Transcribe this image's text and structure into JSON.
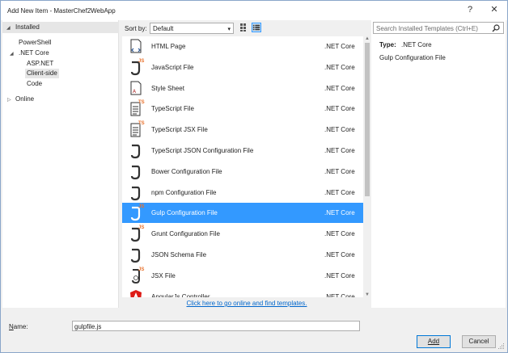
{
  "window": {
    "title": "Add New Item - MasterChef2WebApp",
    "help_glyph": "?",
    "close_glyph": "✕"
  },
  "tree": {
    "installed": "Installed",
    "items": [
      {
        "label": "PowerShell",
        "expander": ""
      },
      {
        "label": ".NET Core",
        "expander": "◢"
      },
      {
        "label": "ASP.NET",
        "expander": ""
      },
      {
        "label": "Client-side",
        "expander": "",
        "selected": true
      },
      {
        "label": "Code",
        "expander": ""
      },
      {
        "label": "Online",
        "expander": "▷"
      }
    ]
  },
  "toolbar": {
    "sort_label": "Sort by:",
    "sort_value": "Default",
    "grid_view_icon": "grid-view-icon",
    "list_view_icon": "list-view-icon"
  },
  "templates": [
    {
      "name": "HTML Page",
      "lang": ".NET Core",
      "icon": "html",
      "badge": ""
    },
    {
      "name": "JavaScript File",
      "lang": ".NET Core",
      "icon": "js",
      "badge": "JS"
    },
    {
      "name": "Style Sheet",
      "lang": ".NET Core",
      "icon": "css",
      "badge": ""
    },
    {
      "name": "TypeScript File",
      "lang": ".NET Core",
      "icon": "ts",
      "badge": "TS"
    },
    {
      "name": "TypeScript JSX File",
      "lang": ".NET Core",
      "icon": "ts",
      "badge": "TS"
    },
    {
      "name": "TypeScript JSON Configuration File",
      "lang": ".NET Core",
      "icon": "json",
      "badge": ""
    },
    {
      "name": "Bower Configuration File",
      "lang": ".NET Core",
      "icon": "json",
      "badge": ""
    },
    {
      "name": "npm Configuration File",
      "lang": ".NET Core",
      "icon": "json",
      "badge": ""
    },
    {
      "name": "Gulp Configuration File",
      "lang": ".NET Core",
      "icon": "js",
      "badge": "JS",
      "selected": true
    },
    {
      "name": "Grunt Configuration File",
      "lang": ".NET Core",
      "icon": "js",
      "badge": "JS"
    },
    {
      "name": "JSON Schema File",
      "lang": ".NET Core",
      "icon": "json",
      "badge": ""
    },
    {
      "name": "JSX File",
      "lang": ".NET Core",
      "icon": "jsx",
      "badge": "JS"
    },
    {
      "name": "AngularJs Controller",
      "lang": ".NET Core",
      "icon": "angular",
      "badge": ""
    }
  ],
  "details": {
    "search_placeholder": "Search Installed Templates (Ctrl+E)",
    "type_label": "Type:",
    "type_value": ".NET Core",
    "description": "Gulp Configuration File"
  },
  "online_link": "Click here to go online and find templates.",
  "footer": {
    "name_label": "Name:",
    "name_value": "gulpfile.js",
    "add_label": "Add",
    "cancel_label": "Cancel"
  },
  "colors": {
    "selection": "#3399ff",
    "link": "#0066cc",
    "js_badge": "#e8702a",
    "ts_badge": "#e8702a",
    "angular": "#dd1b16",
    "html_icon": "#2b5797"
  }
}
